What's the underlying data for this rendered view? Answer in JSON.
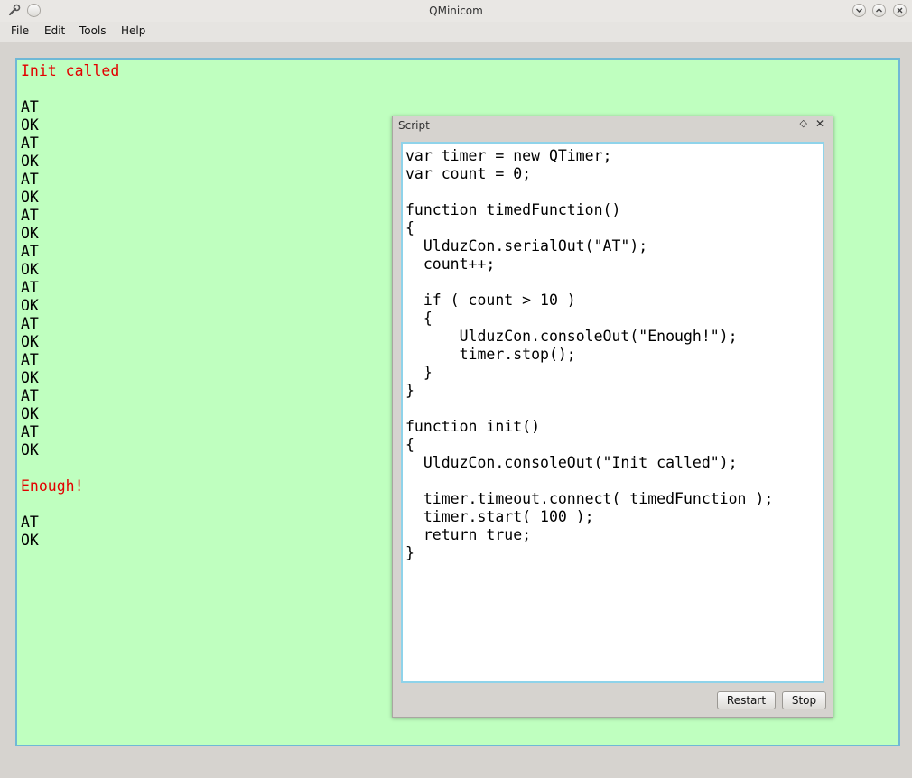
{
  "window": {
    "title": "QMinicom"
  },
  "menu": {
    "items": [
      "File",
      "Edit",
      "Tools",
      "Help"
    ]
  },
  "console": {
    "lines": [
      {
        "text": "Init called",
        "color": "#e30000"
      },
      {
        "text": "",
        "color": "#000000"
      },
      {
        "text": "AT",
        "color": "#000000"
      },
      {
        "text": "OK",
        "color": "#000000"
      },
      {
        "text": "AT",
        "color": "#000000"
      },
      {
        "text": "OK",
        "color": "#000000"
      },
      {
        "text": "AT",
        "color": "#000000"
      },
      {
        "text": "OK",
        "color": "#000000"
      },
      {
        "text": "AT",
        "color": "#000000"
      },
      {
        "text": "OK",
        "color": "#000000"
      },
      {
        "text": "AT",
        "color": "#000000"
      },
      {
        "text": "OK",
        "color": "#000000"
      },
      {
        "text": "AT",
        "color": "#000000"
      },
      {
        "text": "OK",
        "color": "#000000"
      },
      {
        "text": "AT",
        "color": "#000000"
      },
      {
        "text": "OK",
        "color": "#000000"
      },
      {
        "text": "AT",
        "color": "#000000"
      },
      {
        "text": "OK",
        "color": "#000000"
      },
      {
        "text": "AT",
        "color": "#000000"
      },
      {
        "text": "OK",
        "color": "#000000"
      },
      {
        "text": "AT",
        "color": "#000000"
      },
      {
        "text": "OK",
        "color": "#000000"
      },
      {
        "text": "",
        "color": "#000000"
      },
      {
        "text": "Enough!",
        "color": "#e30000"
      },
      {
        "text": "",
        "color": "#000000"
      },
      {
        "text": "AT",
        "color": "#000000"
      },
      {
        "text": "OK",
        "color": "#000000"
      }
    ]
  },
  "script": {
    "title": "Script",
    "code": "var timer = new QTimer;\nvar count = 0;\n\nfunction timedFunction()\n{\n  UlduzCon.serialOut(\"AT\");\n  count++;\n\n  if ( count > 10 )\n  {\n      UlduzCon.consoleOut(\"Enough!\");\n      timer.stop();\n  }\n}\n\nfunction init()\n{\n  UlduzCon.consoleOut(\"Init called\");\n\n  timer.timeout.connect( timedFunction );\n  timer.start( 100 );\n  return true;\n}",
    "restart_label": "Restart",
    "stop_label": "Stop"
  },
  "icons": {
    "app": "wrench-icon",
    "menu": "window-menu-icon",
    "float": "float-diamond-icon",
    "close": "close-icon"
  }
}
